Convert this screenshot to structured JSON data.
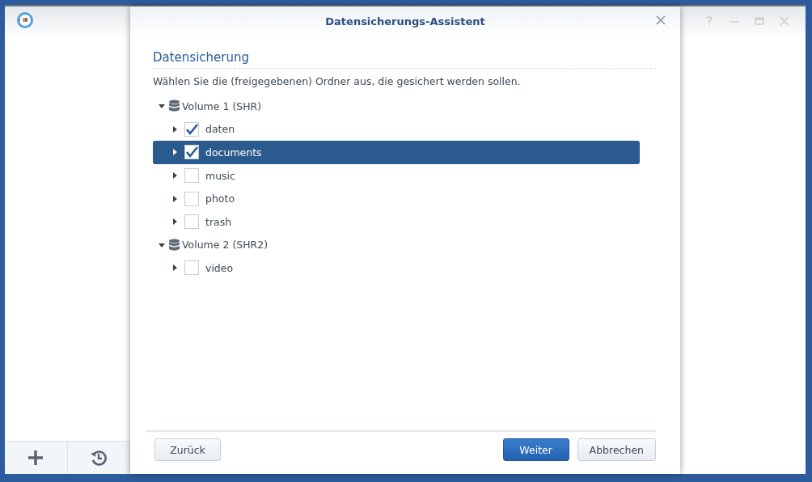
{
  "dialog": {
    "title": "Datensicherungs-Assistent",
    "section_title": "Datensicherung",
    "instruction": "Wählen Sie die (freigegebenen) Ordner aus, die gesichert werden sollen.",
    "tree": [
      {
        "label": "Volume 1 (SHR)",
        "kind": "volume",
        "expanded": true,
        "children": [
          {
            "label": "daten",
            "expanded": false,
            "checked": true,
            "selected": false
          },
          {
            "label": "documents",
            "expanded": false,
            "checked": true,
            "selected": true
          },
          {
            "label": "music",
            "expanded": false,
            "checked": false,
            "selected": false
          },
          {
            "label": "photo",
            "expanded": false,
            "checked": false,
            "selected": false
          },
          {
            "label": "trash",
            "expanded": false,
            "checked": false,
            "selected": false
          }
        ]
      },
      {
        "label": "Volume 2 (SHR2)",
        "kind": "volume",
        "expanded": true,
        "children": [
          {
            "label": "video",
            "expanded": false,
            "checked": false,
            "selected": false
          }
        ]
      }
    ],
    "buttons": [
      {
        "label": "Zurück",
        "kind": "secondary"
      },
      {
        "label": "Weiter",
        "kind": "primary"
      },
      {
        "label": "Abbrechen",
        "kind": "secondary"
      }
    ]
  }
}
